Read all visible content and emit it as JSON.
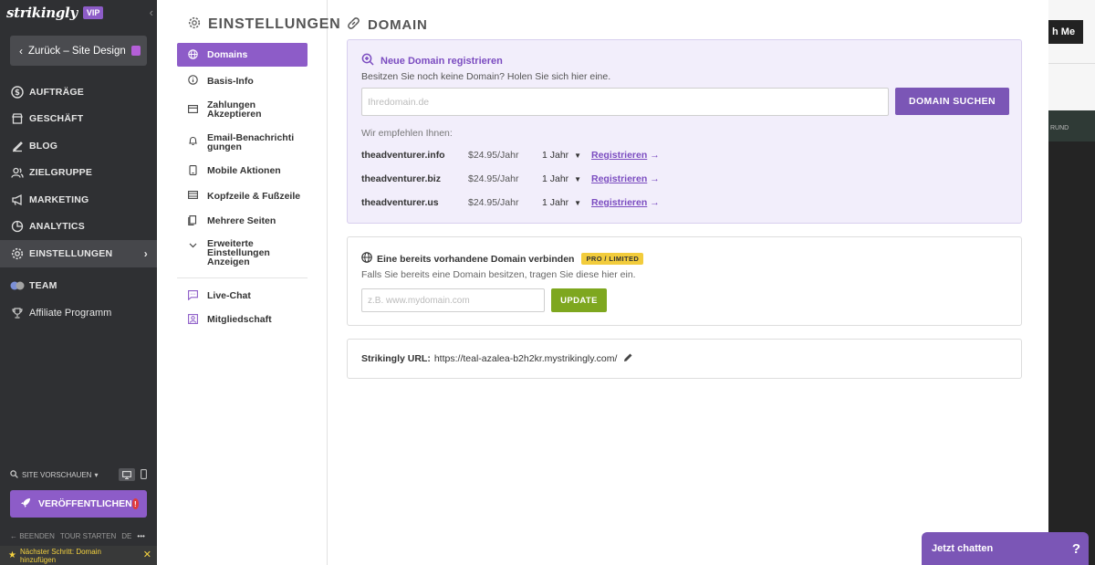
{
  "sidebar": {
    "logo": "strikingly",
    "vip": "VIP",
    "back_label": "Zurück – Site Design",
    "nav": [
      {
        "label": "AUFTRÄGE",
        "icon": "dollar-circle-icon"
      },
      {
        "label": "GESCHÄFT",
        "icon": "store-icon"
      },
      {
        "label": "BLOG",
        "icon": "pen-icon"
      },
      {
        "label": "ZIELGRUPPE",
        "icon": "users-icon"
      },
      {
        "label": "MARKETING",
        "icon": "megaphone-icon"
      },
      {
        "label": "ANALYTICS",
        "icon": "pie-chart-icon"
      },
      {
        "label": "EINSTELLUNGEN",
        "icon": "gear-icon"
      }
    ],
    "team_label": "TEAM",
    "affiliate_label": "Affiliate Programm",
    "preview_label": "SITE VORSCHAUEN",
    "publish_label": "VERÖFFENTLICHEN",
    "bottom_links": [
      "BEENDEN",
      "TOUR STARTEN",
      "DE",
      "•••"
    ],
    "next_step": "Nächster Schritt: Domain hinzufügen"
  },
  "settings_nav": {
    "title": "EINSTELLUNGEN",
    "items": [
      {
        "label": "Domains",
        "icon": "globe-icon"
      },
      {
        "label": "Basis-Info",
        "icon": "info-icon"
      },
      {
        "label": "Zahlungen Akzeptieren",
        "icon": "card-icon"
      },
      {
        "label": "Email-Benachrichtigungen",
        "icon": "bell-icon"
      },
      {
        "label": "Mobile Aktionen",
        "icon": "mobile-icon"
      },
      {
        "label": "Kopfzeile & Fußzeile",
        "icon": "layout-icon"
      },
      {
        "label": "Mehrere Seiten",
        "icon": "pages-icon"
      },
      {
        "label": "Erweiterte Einstellungen Anzeigen",
        "icon": "chevron-down-icon"
      },
      {
        "label": "Live-Chat",
        "icon": "chat-icon"
      },
      {
        "label": "Mitgliedschaft",
        "icon": "member-icon"
      }
    ]
  },
  "domain": {
    "title": "DOMAIN",
    "register_heading": "Neue Domain registrieren",
    "register_sub": "Besitzen Sie noch keine Domain? Holen Sie sich hier eine.",
    "search_placeholder": "Ihredomain.de",
    "search_button": "DOMAIN SUCHEN",
    "recommend_label": "Wir empfehlen Ihnen:",
    "recommendations": [
      {
        "domain": "theadventurer.info",
        "price": "$24.95/Jahr",
        "term": "1 Jahr",
        "action": "Registrieren"
      },
      {
        "domain": "theadventurer.biz",
        "price": "$24.95/Jahr",
        "term": "1 Jahr",
        "action": "Registrieren"
      },
      {
        "domain": "theadventurer.us",
        "price": "$24.95/Jahr",
        "term": "1 Jahr",
        "action": "Registrieren"
      }
    ],
    "connect_heading": "Eine bereits vorhandene Domain verbinden",
    "connect_badge": "PRO / LIMITED",
    "connect_sub": "Falls Sie bereits eine Domain besitzen, tragen Sie diese hier ein.",
    "connect_placeholder": "z.B. www.mydomain.com",
    "update_button": "UPDATE",
    "url_label": "Strikingly URL:",
    "url_value": "https://teal-azalea-b2h2kr.mystrikingly.com/"
  },
  "preview": {
    "button_text": "h Me",
    "band_text": "RUND"
  },
  "chat": {
    "label": "Jetzt chatten",
    "help": "?"
  },
  "colors": {
    "accent": "#8d5cc8",
    "update": "#7ea71f",
    "badge": "#f2cc3c"
  }
}
